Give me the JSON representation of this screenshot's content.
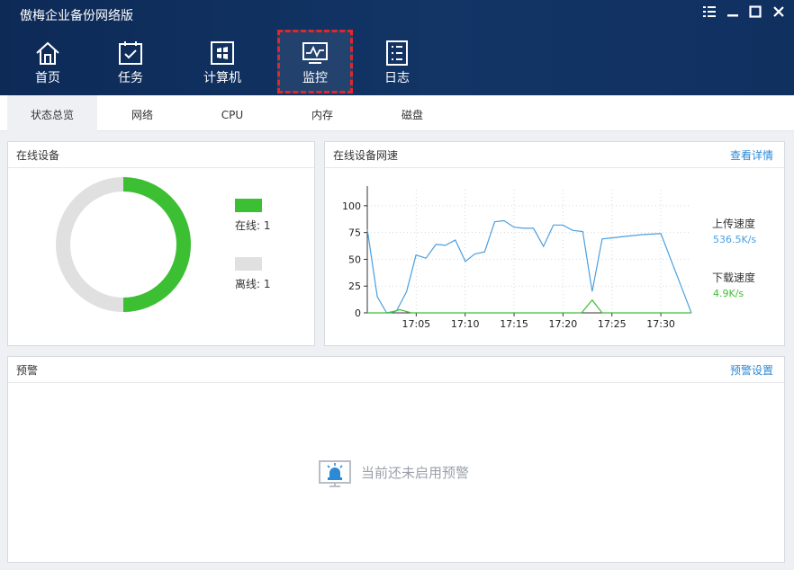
{
  "app": {
    "title": "傲梅企业备份网络版"
  },
  "window_controls": [
    {
      "name": "menu-icon",
      "glyph": "☰"
    },
    {
      "name": "minimize-icon",
      "glyph": "—"
    },
    {
      "name": "maximize-icon",
      "glyph": "□"
    },
    {
      "name": "close-icon",
      "glyph": "✕"
    }
  ],
  "nav": {
    "items": [
      {
        "label": "首页",
        "icon": "home-icon"
      },
      {
        "label": "任务",
        "icon": "task-icon"
      },
      {
        "label": "计算机",
        "icon": "computer-icon"
      },
      {
        "label": "监控",
        "icon": "monitor-icon",
        "active": true
      },
      {
        "label": "日志",
        "icon": "log-icon"
      }
    ]
  },
  "tabs": [
    {
      "label": "状态总览",
      "active": true
    },
    {
      "label": "网络"
    },
    {
      "label": "CPU"
    },
    {
      "label": "内存"
    },
    {
      "label": "磁盘"
    }
  ],
  "online_devices": {
    "title": "在线设备",
    "online_label": "在线: 1",
    "offline_label": "离线: 1",
    "online_count": 1,
    "offline_count": 1,
    "online_color": "#3dbf33",
    "offline_color": "#e0e0e0"
  },
  "network_speed": {
    "title": "在线设备网速",
    "details_link": "查看详情",
    "upload_label": "上传速度",
    "upload_value": "536.5K/s",
    "upload_color": "#4a9fe0",
    "download_label": "下载速度",
    "download_value": "4.9K/s",
    "download_color": "#3dbf33"
  },
  "alerts": {
    "title": "预警",
    "settings_link": "预警设置",
    "empty_message": "当前还未启用预警"
  },
  "chart_data": {
    "type": "line",
    "y_ticks": [
      "100",
      "75",
      "50",
      "25",
      "0"
    ],
    "x_ticks": [
      "17:05",
      "17:10",
      "17:15",
      "17:20",
      "17:25",
      "17:30"
    ],
    "ylim": [
      0,
      115
    ],
    "xlim": [
      17.0,
      17.552
    ],
    "grid": true,
    "series": [
      {
        "name": "上传速度",
        "color": "#4a9fe0",
        "points": [
          [
            17.0,
            78
          ],
          [
            17.017,
            15
          ],
          [
            17.033,
            0
          ],
          [
            17.05,
            2
          ],
          [
            17.067,
            20
          ],
          [
            17.083,
            54
          ],
          [
            17.1,
            51
          ],
          [
            17.117,
            64
          ],
          [
            17.133,
            63
          ],
          [
            17.15,
            68
          ],
          [
            17.167,
            48
          ],
          [
            17.183,
            55
          ],
          [
            17.2,
            57
          ],
          [
            17.217,
            85
          ],
          [
            17.233,
            86
          ],
          [
            17.25,
            80
          ],
          [
            17.267,
            79
          ],
          [
            17.283,
            79
          ],
          [
            17.3,
            62
          ],
          [
            17.317,
            82
          ],
          [
            17.333,
            82
          ],
          [
            17.35,
            77
          ],
          [
            17.367,
            76
          ],
          [
            17.383,
            20
          ],
          [
            17.4,
            69
          ],
          [
            17.417,
            70
          ],
          [
            17.433,
            71
          ],
          [
            17.467,
            73
          ],
          [
            17.5,
            74
          ],
          [
            17.552,
            0
          ]
        ]
      },
      {
        "name": "下载速度",
        "color": "#3dbf33",
        "points": [
          [
            17.0,
            0
          ],
          [
            17.04,
            0
          ],
          [
            17.055,
            3
          ],
          [
            17.075,
            0
          ],
          [
            17.365,
            0
          ],
          [
            17.383,
            12
          ],
          [
            17.4,
            0
          ],
          [
            17.552,
            0
          ]
        ]
      }
    ]
  }
}
